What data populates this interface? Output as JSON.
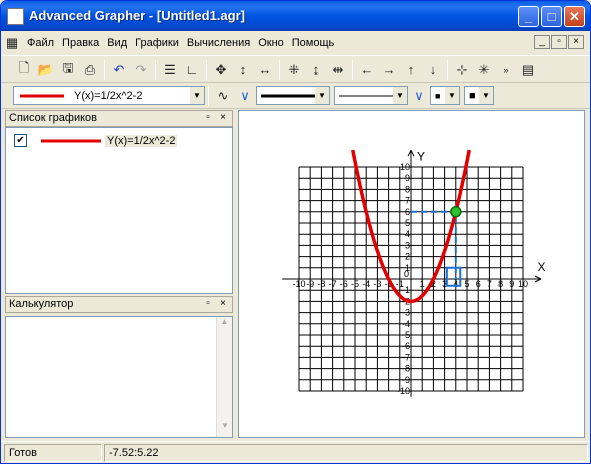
{
  "window": {
    "title": "Advanced Grapher - [Untitled1.agr]",
    "buttons": {
      "minimize": "_",
      "maximize": "□",
      "close": "✕"
    }
  },
  "menu": [
    "Файл",
    "Правка",
    "Вид",
    "Графики",
    "Вычисления",
    "Окно",
    "Помощь"
  ],
  "mdi": {
    "minimize": "_",
    "restore": "▫",
    "close": "×"
  },
  "toolbar2": {
    "graph_combo": "Y(x)=1/2x^2-2",
    "line_color": "#e00000"
  },
  "graphs_panel": {
    "title": "Список графиков",
    "items": [
      {
        "label": "Y(x)=1/2x^2-2",
        "checked": "✔",
        "color": "#e00000"
      }
    ]
  },
  "calc_panel": {
    "title": "Калькулятор"
  },
  "statusbar": {
    "state": "Готов",
    "coords": "-7.52:5.22"
  },
  "plot": {
    "x_axis_label": "X",
    "y_axis_label": "Y",
    "x_ticks": [
      "-10",
      "-9",
      "-8",
      "-7",
      "-6",
      "-5",
      "-4",
      "-3",
      "-2",
      "-1",
      "1",
      "2",
      "3",
      "4",
      "5",
      "6",
      "7",
      "8",
      "9",
      "10"
    ],
    "y_ticks": [
      "10",
      "9",
      "8",
      "7",
      "6",
      "5",
      "4",
      "3",
      "2",
      "1",
      "-1",
      "-2",
      "-3",
      "-4",
      "-5",
      "-6",
      "-7",
      "-8",
      "-9",
      "-10"
    ],
    "origin_label": "0",
    "curve_color": "#e00000",
    "marker": {
      "x": 4,
      "y": 6
    },
    "xlim": [
      -10,
      10
    ],
    "ylim": [
      -10,
      10
    ]
  },
  "chart_data": {
    "type": "line",
    "series": [
      {
        "name": "Y(x)=1/2x^2-2",
        "x": [
          -5.2,
          -5,
          -4,
          -3,
          -2,
          -1,
          0,
          1,
          2,
          3,
          4,
          5,
          5.2
        ],
        "y": [
          11.5,
          10.5,
          6,
          2.5,
          0,
          -1.5,
          -2,
          -1.5,
          0,
          2.5,
          6,
          10.5,
          11.5
        ]
      }
    ],
    "xlabel": "X",
    "ylabel": "Y",
    "xlim": [
      -10,
      10
    ],
    "ylim": [
      -10,
      10
    ],
    "grid": true
  }
}
